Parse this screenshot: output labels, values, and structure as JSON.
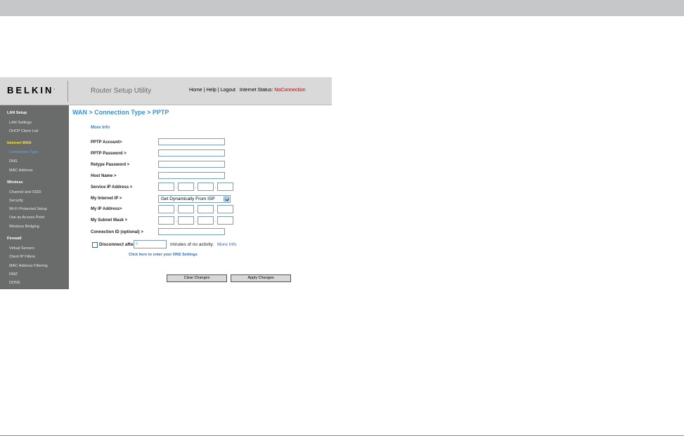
{
  "header": {
    "logo": "BELKIN",
    "logo_mark": ".",
    "app_title": "Router Setup Utility",
    "links": {
      "home": "Home",
      "sep1": "|",
      "help": "Help",
      "sep2": "|",
      "logout": "Logout"
    },
    "status_label": "Internet Status:",
    "status_value": "NoConnection",
    "status_color": "#c00000"
  },
  "sidebar": {
    "groups": [
      {
        "label": "LAN Setup",
        "items": [
          "LAN Settings",
          "DHCP Client List"
        ]
      },
      {
        "label": "Internet WAN",
        "items": [
          "Connection Type",
          "DNS",
          "MAC Address"
        ]
      },
      {
        "label": "Wireless",
        "items": [
          "Channel and SSID",
          "Security",
          "Wi-Fi Protected Setup",
          "Use as Access Point",
          "Wireless Bridging"
        ]
      },
      {
        "label": "Firewall",
        "items": [
          "Virtual Servers",
          "Client IP Filters",
          "MAC Address Filtering",
          "DMZ",
          "DDNS"
        ]
      }
    ],
    "active_item": "Connection Type",
    "accent_active_group": "#f2e23a",
    "accent_active_item": "#5aa9ff"
  },
  "main": {
    "breadcrumb": "WAN > Connection Type > PPTP",
    "more_info": "More Info",
    "form": {
      "pptp_account": {
        "label": "PPTP Account>",
        "value": ""
      },
      "pptp_password": {
        "label": "PPTP Password >",
        "value": ""
      },
      "retype_password": {
        "label": "Retype Password >",
        "value": ""
      },
      "host_name": {
        "label": "Host Name >",
        "value": ""
      },
      "service_ip": {
        "label": "Service IP Address >",
        "octets": [
          "",
          "",
          "",
          ""
        ]
      },
      "my_internet_ip": {
        "label": "My Internet IP >",
        "selected": "Get Dynamically From ISP"
      },
      "my_ip": {
        "label": "My IP Address>",
        "octets": [
          "",
          "",
          "",
          ""
        ]
      },
      "subnet_mask": {
        "label": "My Subnet Mask >",
        "octets": [
          "",
          "",
          "",
          ""
        ]
      },
      "connection_id": {
        "label": "Connection ID (optional) >",
        "value": ""
      }
    },
    "disconnect": {
      "label": "Disconnect after",
      "minutes_placeholder": "5",
      "suffix": "minutes of no activity.",
      "more_info": "More Info",
      "checked": false
    },
    "dns_link": "Click here to enter your DNS Settings",
    "buttons": {
      "clear": "Clear Changes",
      "apply": "Apply Changes"
    }
  },
  "colors": {
    "breadcrumb": "#3a8fd6",
    "sidebar_bg": "#6a6b6b",
    "header_bg": "#d9d9d9",
    "link": "#2f6cc2"
  }
}
